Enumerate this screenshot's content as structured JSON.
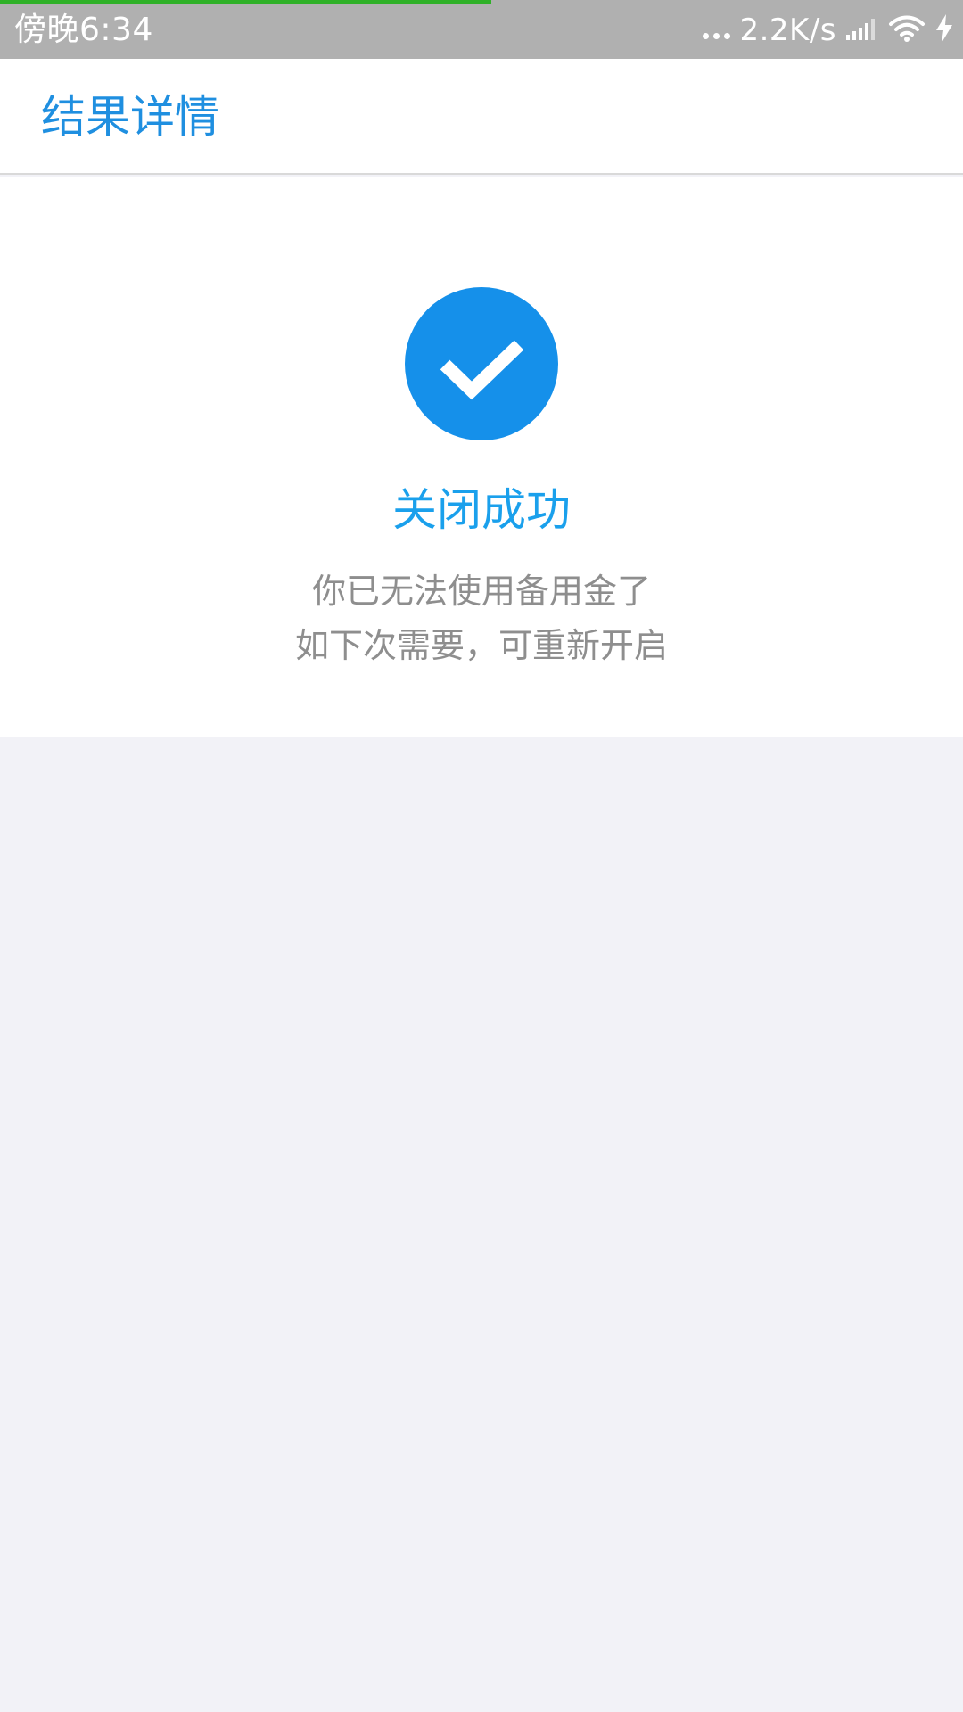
{
  "status_bar": {
    "time": "傍晚6:34",
    "network_speed": "2.2K/s",
    "progress": 0.51,
    "icons": [
      "signal-icon",
      "wifi-icon",
      "charging-bolt-icon"
    ]
  },
  "header": {
    "title": "结果详情"
  },
  "result": {
    "icon": "checkmark-icon",
    "title": "关闭成功",
    "description_line_1": "你已无法使用备用金了",
    "description_line_2": "如下次需要，可重新开启"
  },
  "colors": {
    "status_bar_background": "#b0b0b0",
    "progress": "#2fb128",
    "header_title": "#1f8fe0",
    "success_icon": "#1590ea",
    "result_title": "#1aa0ec",
    "description": "#8e8e8e",
    "page_background": "#f2f2f7"
  }
}
